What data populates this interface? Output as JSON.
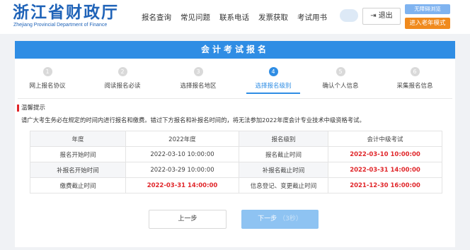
{
  "header": {
    "logo_cn": "浙江省财政厅",
    "logo_en": "Zhejiang Provincial Department of Finance",
    "nav": [
      "报名查询",
      "常见问题",
      "联系电话",
      "发票获取",
      "考试用书"
    ],
    "logout_label": "退出",
    "accessibility_label": "无障碍浏览",
    "elder_mode_label": "进入老年模式"
  },
  "card": {
    "title": "会计考试报名",
    "steps": [
      {
        "num": "1",
        "label": "网上报名协议"
      },
      {
        "num": "2",
        "label": "阅读报名必读"
      },
      {
        "num": "3",
        "label": "选择报名地区"
      },
      {
        "num": "4",
        "label": "选择报名级别"
      },
      {
        "num": "5",
        "label": "确认个人信息"
      },
      {
        "num": "6",
        "label": "采集报名信息"
      }
    ],
    "active_step": 4,
    "tip_title": "温馨提示",
    "tip_text": "请广大考生务必在规定的时间内进行报名和缴费。错过下方报名和补报名时间的，将无法参加2022年度会计专业技术中级资格考试。",
    "table": [
      [
        "年度",
        "2022年度",
        "报名级别",
        "会计中级考试"
      ],
      [
        "报名开始时间",
        "2022-03-10 10:00:00",
        "报名截止时间",
        "2022-03-10 10:00:00"
      ],
      [
        "补报名开始时间",
        "2022-03-29 10:00:00",
        "补报名截止时间",
        "2022-03-31 14:00:00"
      ],
      [
        "缴费截止时间",
        "2022-03-31 14:00:00",
        "信息登记、变更截止时间",
        "2021-12-30 16:00:00"
      ]
    ],
    "prev_label": "上一步",
    "next_label": "下一步",
    "next_countdown": "（3秒）"
  },
  "colors": {
    "brand_blue": "#2f8de4",
    "logo_blue": "#1f63b8",
    "alert_red": "#e0262a",
    "elder_orange": "#f08a1d"
  },
  "icons": {
    "logout": "logout-icon"
  }
}
